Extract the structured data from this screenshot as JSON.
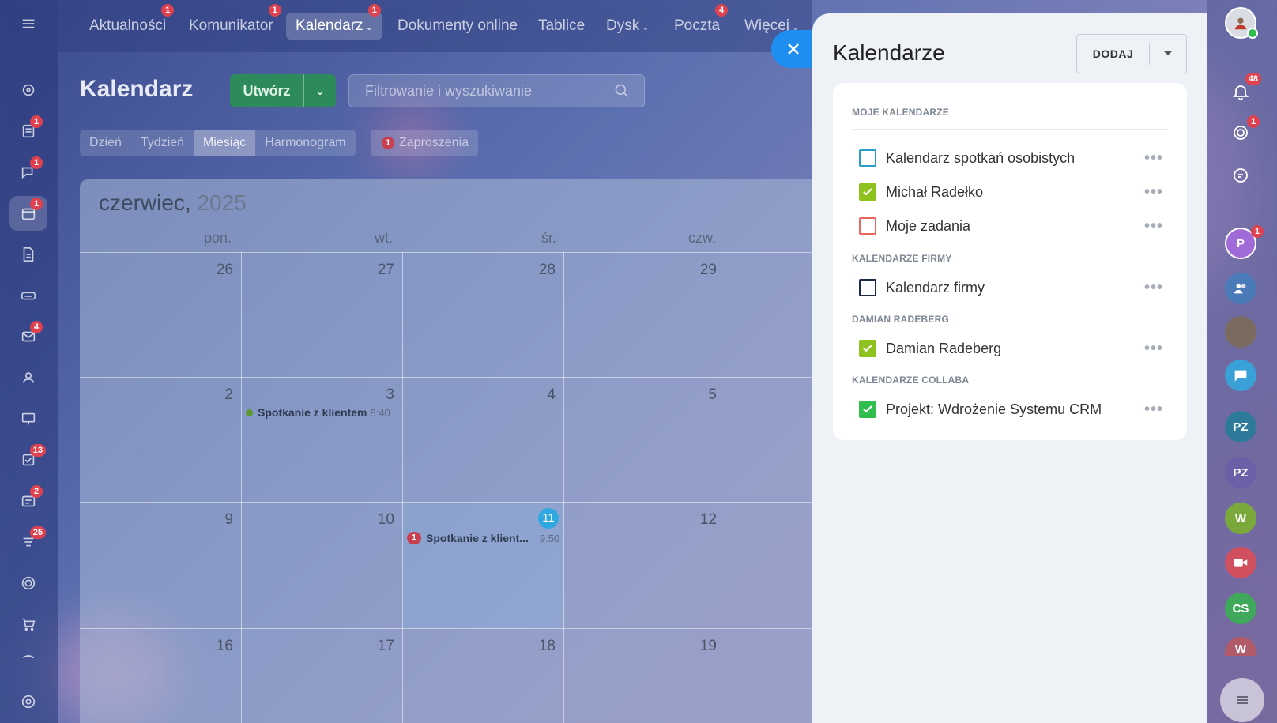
{
  "topnav": {
    "items": [
      {
        "label": "Aktualności",
        "badge": "1"
      },
      {
        "label": "Komunikator",
        "badge": "1"
      },
      {
        "label": "Kalendarz",
        "badge": "1"
      },
      {
        "label": "Dokumenty online",
        "badge": ""
      },
      {
        "label": "Tablice",
        "badge": ""
      },
      {
        "label": "Dysk",
        "badge": ""
      },
      {
        "label": "Poczta",
        "badge": "4"
      },
      {
        "label": "Więcej",
        "badge": ""
      }
    ]
  },
  "left_sidebar": {
    "badges": [
      "1",
      "1",
      "1",
      "4",
      "13",
      "2",
      "25"
    ]
  },
  "header": {
    "title": "Kalendarz",
    "create_label": "Utwórz",
    "search_placeholder": "Filtrowanie i wyszukiwanie"
  },
  "view_tabs": [
    "Dzień",
    "Tydzień",
    "Miesiąc",
    "Harmonogram"
  ],
  "invites": {
    "label": "Zaproszenia",
    "count": "1"
  },
  "calendar": {
    "month": "czerwiec,",
    "year": "2025",
    "days_of_week": [
      "pon.",
      "wt.",
      "śr.",
      "czw."
    ],
    "weeks": [
      [
        "26",
        "27",
        "28",
        "29"
      ],
      [
        "2",
        "3",
        "4",
        "5"
      ],
      [
        "9",
        "10",
        "11",
        "12"
      ],
      [
        "16",
        "17",
        "18",
        "19"
      ]
    ],
    "events": [
      {
        "title": "Spotkanie z klientem",
        "time": "8:40"
      },
      {
        "title": "Spotkanie z klient...",
        "time": "9:50",
        "badge": "1"
      }
    ]
  },
  "panel": {
    "title": "Kalendarze",
    "add_label": "DODAJ",
    "sections": [
      {
        "title": "MOJE KALENDARZE",
        "items": [
          {
            "name": "Kalendarz spotkań osobistych",
            "checked": false,
            "color": "#2b9ccf"
          },
          {
            "name": "Michał Radełko",
            "checked": true,
            "color": "#8dc21f"
          },
          {
            "name": "Moje zadania",
            "checked": false,
            "color": "#e8675f"
          }
        ]
      },
      {
        "title": "KALENDARZE FIRMY",
        "items": [
          {
            "name": "Kalendarz firmy",
            "checked": false,
            "color": "#1c2a48"
          }
        ]
      },
      {
        "title": "DAMIAN RADEBERG",
        "items": [
          {
            "name": "Damian Radeberg",
            "checked": true,
            "color": "#8dc21f"
          }
        ]
      },
      {
        "title": "KALENDARZE COLLABA",
        "items": [
          {
            "name": "Projekt: Wdrożenie Systemu CRM",
            "checked": true,
            "color": "#2fbf4f"
          }
        ]
      }
    ]
  },
  "right_sidebar": {
    "notification_badge": "48",
    "goals_badge": "1",
    "avatars": [
      {
        "initials": "P",
        "color": "#a06ad8",
        "badge": "1"
      },
      {
        "initials": "PZ",
        "color": "#2d7a9a"
      },
      {
        "initials": "PZ",
        "color": "#6c5fa8"
      },
      {
        "initials": "W",
        "color": "#7aa83a"
      },
      {
        "initials": "CS",
        "color": "#3fa85a"
      },
      {
        "initials": "W",
        "color": "#b05a6a"
      }
    ]
  }
}
